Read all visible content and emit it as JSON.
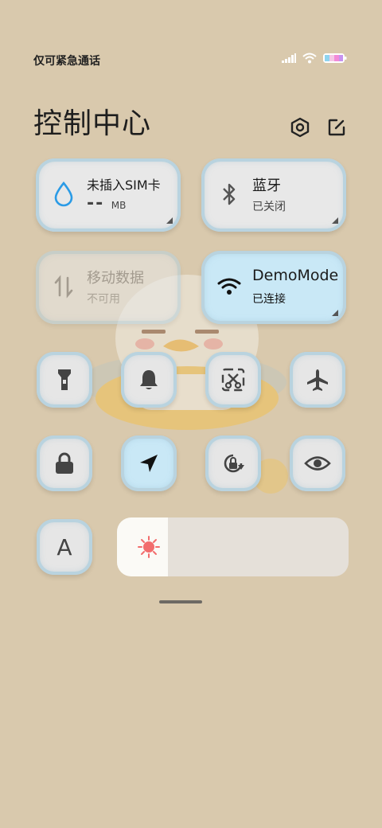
{
  "status_bar": {
    "carrier_text": "仅可紧急通话",
    "icons": [
      "signal-icon",
      "wifi-icon",
      "battery-icon"
    ]
  },
  "header": {
    "title": "控制中心",
    "icons": [
      "settings-icon",
      "edit-icon"
    ]
  },
  "tiles": {
    "data_usage": {
      "title": "未插入SIM卡",
      "value": "--",
      "unit": "MB",
      "icon": "water-drop-icon",
      "accent": "#2b9be6"
    },
    "bluetooth": {
      "title": "蓝牙",
      "status": "已关闭",
      "icon": "bluetooth-icon"
    },
    "mobile_data": {
      "title": "移动数据",
      "status": "不可用",
      "icon": "data-arrows-icon"
    },
    "wifi": {
      "title": "DemoMode",
      "status": "已连接",
      "icon": "wifi-icon",
      "accent": "#c9e8f6"
    }
  },
  "quick_toggles_row1": [
    {
      "name": "flashlight",
      "icon": "flashlight-icon"
    },
    {
      "name": "mute",
      "icon": "bell-icon"
    },
    {
      "name": "screenshot",
      "icon": "scissors-icon"
    },
    {
      "name": "airplane",
      "icon": "airplane-icon"
    }
  ],
  "quick_toggles_row2": [
    {
      "name": "lock-screen",
      "icon": "lock-icon"
    },
    {
      "name": "location",
      "icon": "location-arrow-icon",
      "active": true
    },
    {
      "name": "rotation-lock",
      "icon": "rotation-lock-icon"
    },
    {
      "name": "reading-mode",
      "icon": "eye-icon"
    }
  ],
  "auto_brightness": {
    "label": "A"
  },
  "brightness": {
    "level": 0.22,
    "icon": "sun-icon",
    "icon_color": "#f26d6d"
  }
}
